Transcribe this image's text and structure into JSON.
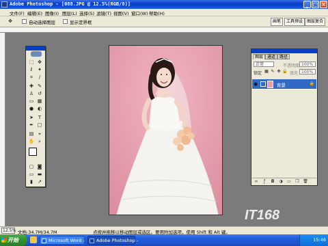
{
  "window": {
    "title": "Adobe Photoshop - [088.JPG @ 12.5%(RGB/8)]"
  },
  "menu": [
    "文件(F)",
    "编辑(E)",
    "图像(I)",
    "图层(L)",
    "选择(S)",
    "滤镜(T)",
    "视图(V)",
    "窗口(W)",
    "帮助(H)"
  ],
  "options": {
    "auto_select_layer": "自动选择图层",
    "show_bounds": "显示定界框",
    "tabs": [
      "画笔",
      "工具预设",
      "图层复合"
    ]
  },
  "layers_panel": {
    "tabs": [
      "图层",
      "通道",
      "路径"
    ],
    "blend_mode": "正常",
    "opacity_label": "不透明度",
    "opacity_value": "100%",
    "lock_label": "锁定",
    "fill_label": "填充",
    "fill_value": "100%",
    "layer_name": "背景"
  },
  "status": {
    "zoom": "12.5%",
    "doc_info": "文档:34.7M/34.7M",
    "tip": "点按并拖移以移动图层或选区。要用附加选项，使用 Shift 和 Alt 键。"
  },
  "taskbar": {
    "start_label": "开始",
    "tasks": [
      "Microsoft Word -",
      "Adobe Photoshop -"
    ],
    "clock": "15:46"
  },
  "watermark": {
    "text": "IT168"
  },
  "colors": {
    "canvas_bg": "#e8a0ad",
    "xp_blue": "#0a3fc8",
    "panel_bg": "#ece9d8"
  }
}
